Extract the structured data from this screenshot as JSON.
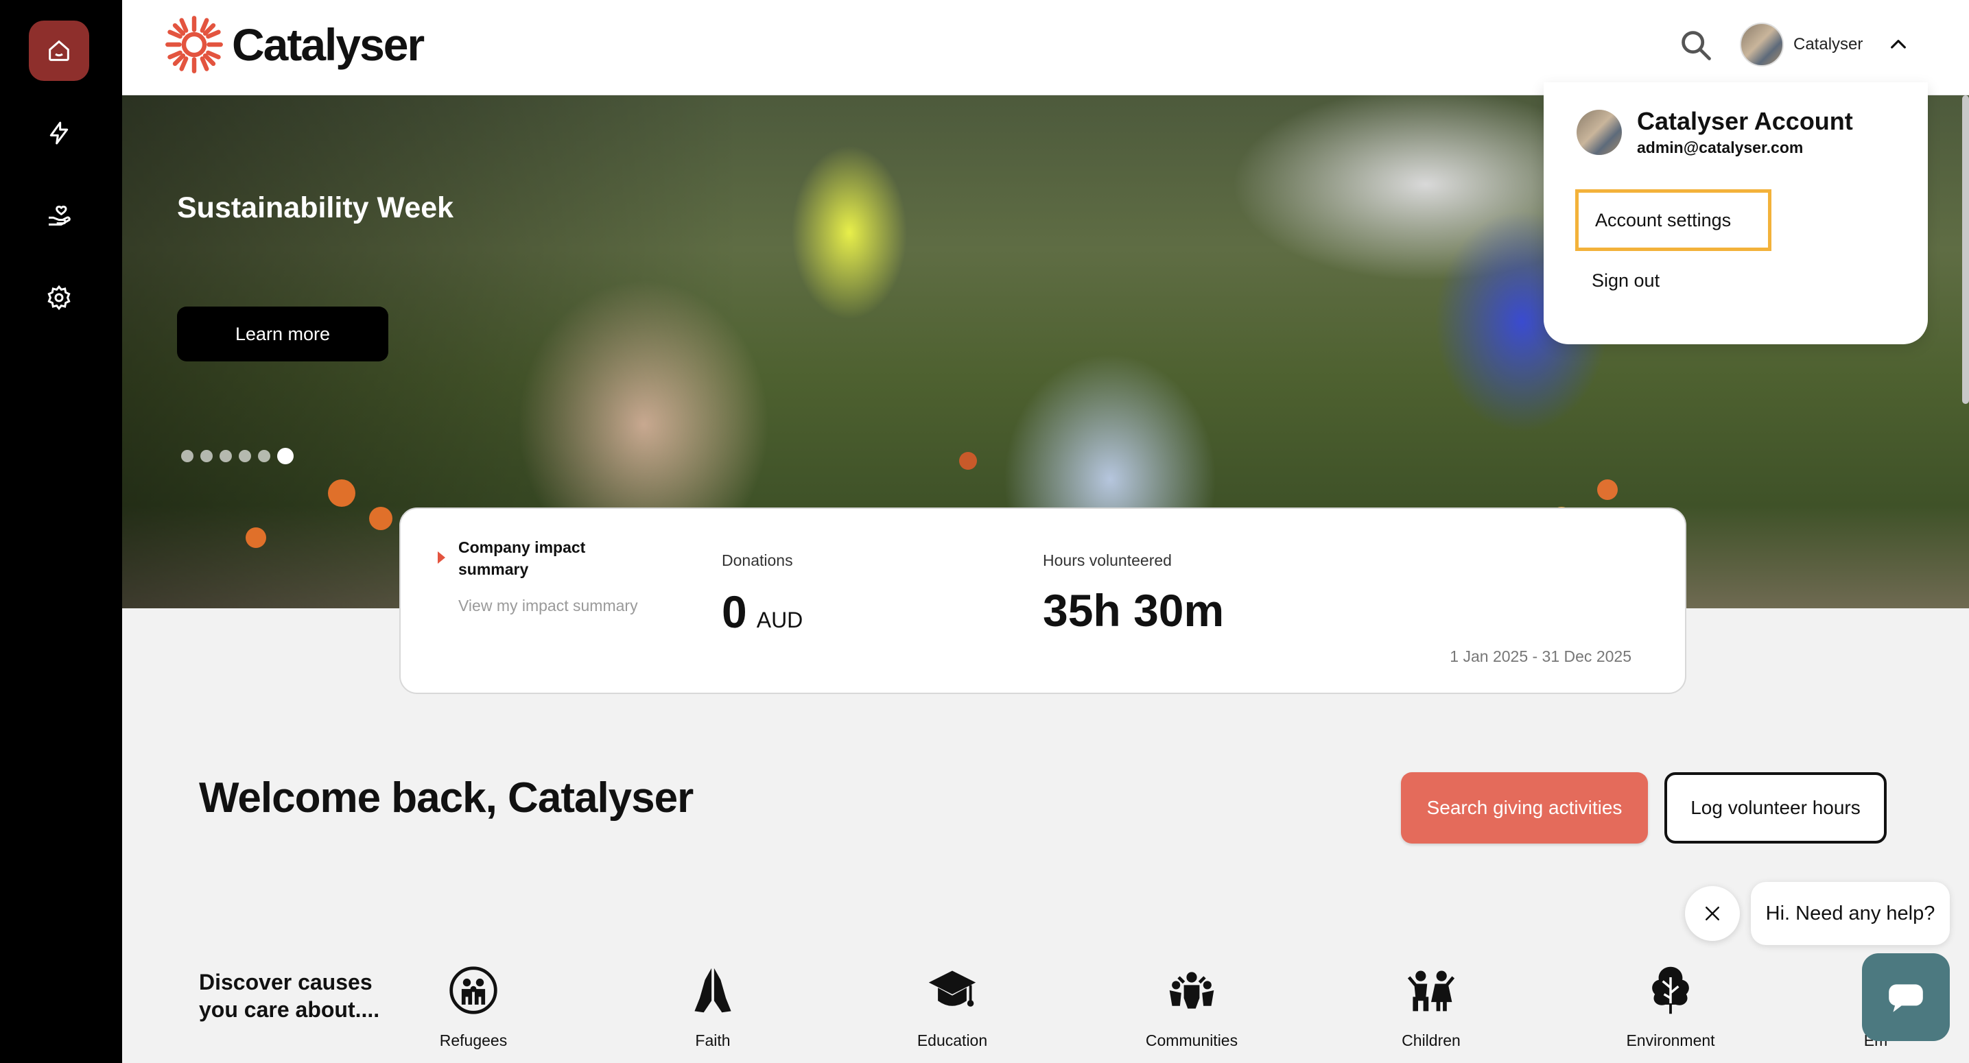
{
  "brand": {
    "name": "Catalyser",
    "accent": "#e46b5b",
    "logo_color": "#e3543f"
  },
  "sidebar": {
    "items": [
      {
        "icon": "home-icon",
        "active": true
      },
      {
        "icon": "lightning-icon",
        "active": false
      },
      {
        "icon": "hand-heart-icon",
        "active": false
      },
      {
        "icon": "gear-icon",
        "active": false
      }
    ]
  },
  "header": {
    "user_name": "Catalyser"
  },
  "hero": {
    "title": "Sustainability Week",
    "cta_label": "Learn more",
    "slide_count": 6,
    "active_slide": 6
  },
  "impact": {
    "title": "Company impact summary",
    "link_label": "View my impact summary",
    "donations_label": "Donations",
    "donations_value": "0",
    "donations_unit": "AUD",
    "hours_label": "Hours volunteered",
    "hours_value": "35h 30m",
    "date_range": "1 Jan 2025 - 31 Dec 2025"
  },
  "welcome": {
    "heading": "Welcome back, Catalyser",
    "primary_button": "Search giving activities",
    "secondary_button": "Log volunteer hours"
  },
  "causes": {
    "heading": "Discover causes you care about....",
    "items": [
      {
        "label": "Refugees",
        "icon": "refugees-icon"
      },
      {
        "label": "Faith",
        "icon": "praying-hands-icon"
      },
      {
        "label": "Education",
        "icon": "graduation-cap-icon"
      },
      {
        "label": "Communities",
        "icon": "community-icon"
      },
      {
        "label": "Children",
        "icon": "children-icon"
      },
      {
        "label": "Environment",
        "icon": "tree-icon"
      },
      {
        "label": "Em",
        "icon": ""
      }
    ]
  },
  "account_menu": {
    "name": "Catalyser Account",
    "email": "admin@catalyser.com",
    "settings_label": "Account settings",
    "signout_label": "Sign out"
  },
  "chat": {
    "greeting": "Hi. Need any help?"
  }
}
